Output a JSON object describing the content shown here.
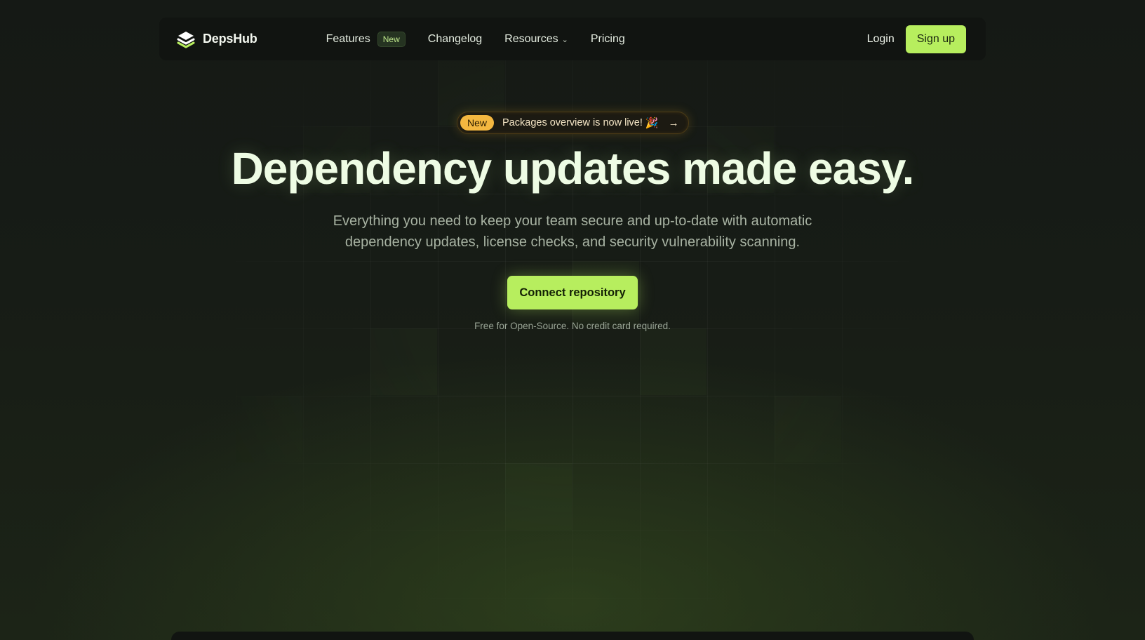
{
  "brand": {
    "name": "DepsHub",
    "logo_icon": "stacked-layers-icon",
    "accent_color": "#b7ee5e"
  },
  "nav": {
    "items": [
      {
        "label": "Features",
        "badge": "New"
      },
      {
        "label": "Changelog"
      },
      {
        "label": "Resources",
        "icon": "chevron-down-icon"
      },
      {
        "label": "Pricing"
      }
    ],
    "login_label": "Login",
    "signup_label": "Sign up"
  },
  "announcement": {
    "badge": "New",
    "text": "Packages overview is now live!",
    "emoji_icon": "party-popper-icon",
    "emoji": "🎉",
    "arrow": "→",
    "badge_color": "#f4b740"
  },
  "hero": {
    "title": "Dependency updates made easy.",
    "subtitle_line1": "Everything you need to keep your team secure and up-to-date with automatic",
    "subtitle_line2": "dependency updates, license checks, and security vulnerability scanning.",
    "cta_label": "Connect repository",
    "cta_note": "Free for Open-Source. No credit card required."
  }
}
